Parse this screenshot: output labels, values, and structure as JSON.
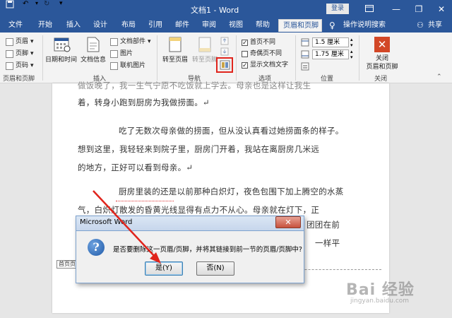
{
  "titlebar": {
    "doc_title": "文档1 - Word",
    "login": "登录",
    "controls": [
      "—",
      "❐",
      "✕"
    ]
  },
  "tabs": [
    "文件",
    "开始",
    "插入",
    "设计",
    "布局",
    "引用",
    "邮件",
    "审阅",
    "视图",
    "帮助",
    "页眉和页脚",
    "操作说明搜索",
    "共享"
  ],
  "ribbon": {
    "hf_group": {
      "items": [
        "页眉",
        "页脚",
        "页码"
      ],
      "label": "页眉和页脚"
    },
    "insert_group": {
      "datetime": "日期和时间",
      "docinfo": "文档信息",
      "small": [
        "文档部件",
        "图片",
        "联机图片"
      ],
      "label": "插入"
    },
    "nav_group": {
      "goto_header": "转至页眉",
      "goto_footer": "转至页脚",
      "label": "导航"
    },
    "options_group": {
      "items": [
        {
          "label": "首页不同",
          "checked": true
        },
        {
          "label": "奇偶页不同",
          "checked": false
        },
        {
          "label": "显示文档文字",
          "checked": true
        }
      ],
      "label": "选项"
    },
    "position_group": {
      "header_val": "1.5 厘米",
      "footer_val": "1.75 厘米",
      "label": "位置"
    },
    "close_group": {
      "button": "关闭\n页眉和页脚",
      "label": "关闭"
    }
  },
  "document": {
    "lines": [
      "做饭晚了，我一生气宁愿不吃饭就上学去。母亲也是这样让我生",
      "着，转身小跑到厨房为我做捞面。↵",
      "吃了无数次母亲做的捞面，但从没认真看过她捞面条的样子。",
      "想到这里，我轻轻来到院子里，厨房门开着，我站在离厨房几米远",
      "的地方，正好可以看到母亲。↵",
      "厨房里装的还是以前那种白炽灯，夜色包围下加上腾空的水蒸",
      "气，白炽灯散发的昏黄光线显得有点力不从心。母亲就在灯下，正",
      "团团在前",
      "一样平"
    ],
    "header_tag": "首页页"
  },
  "dialog": {
    "title": "Microsoft Word",
    "close": "✕",
    "icon": "question-icon",
    "message": "是否要删除这一页眉/页脚，并将其链接到前一节的页眉/页脚中?",
    "yes": "是(Y)",
    "no": "否(N)"
  },
  "watermark": {
    "text": "Bai 经验",
    "sub": "jingyan.baidu.com"
  },
  "colors": {
    "word_blue": "#2b579a",
    "annotation_red": "#e0241c"
  }
}
